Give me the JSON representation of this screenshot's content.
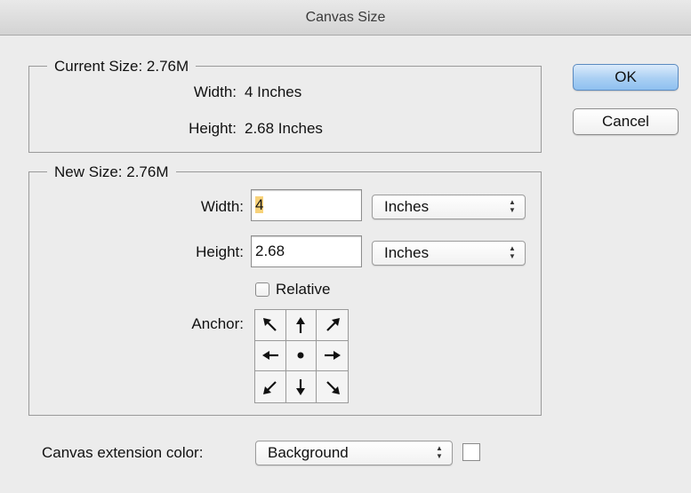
{
  "window": {
    "title": "Canvas Size"
  },
  "current_size": {
    "legend": "Current Size: 2.76M",
    "width_label": "Width:",
    "width_value": "4 Inches",
    "height_label": "Height:",
    "height_value": "2.68 Inches"
  },
  "new_size": {
    "legend": "New Size: 2.76M",
    "width_label": "Width:",
    "width_value": "4",
    "width_unit": "Inches",
    "height_label": "Height:",
    "height_value": "2.68",
    "height_unit": "Inches",
    "relative_label": "Relative",
    "relative_checked": false,
    "anchor_label": "Anchor:",
    "anchor_cells": [
      "arrow-up-left",
      "arrow-up",
      "arrow-up-right",
      "arrow-left",
      "center-dot",
      "arrow-right",
      "arrow-down-left",
      "arrow-down",
      "arrow-down-right"
    ]
  },
  "extension": {
    "label": "Canvas extension color:",
    "value": "Background",
    "swatch_color": "#ffffff"
  },
  "buttons": {
    "ok": "OK",
    "cancel": "Cancel"
  },
  "colors": {
    "default_button": "#a9cff3",
    "selection": "#f8d27a"
  }
}
